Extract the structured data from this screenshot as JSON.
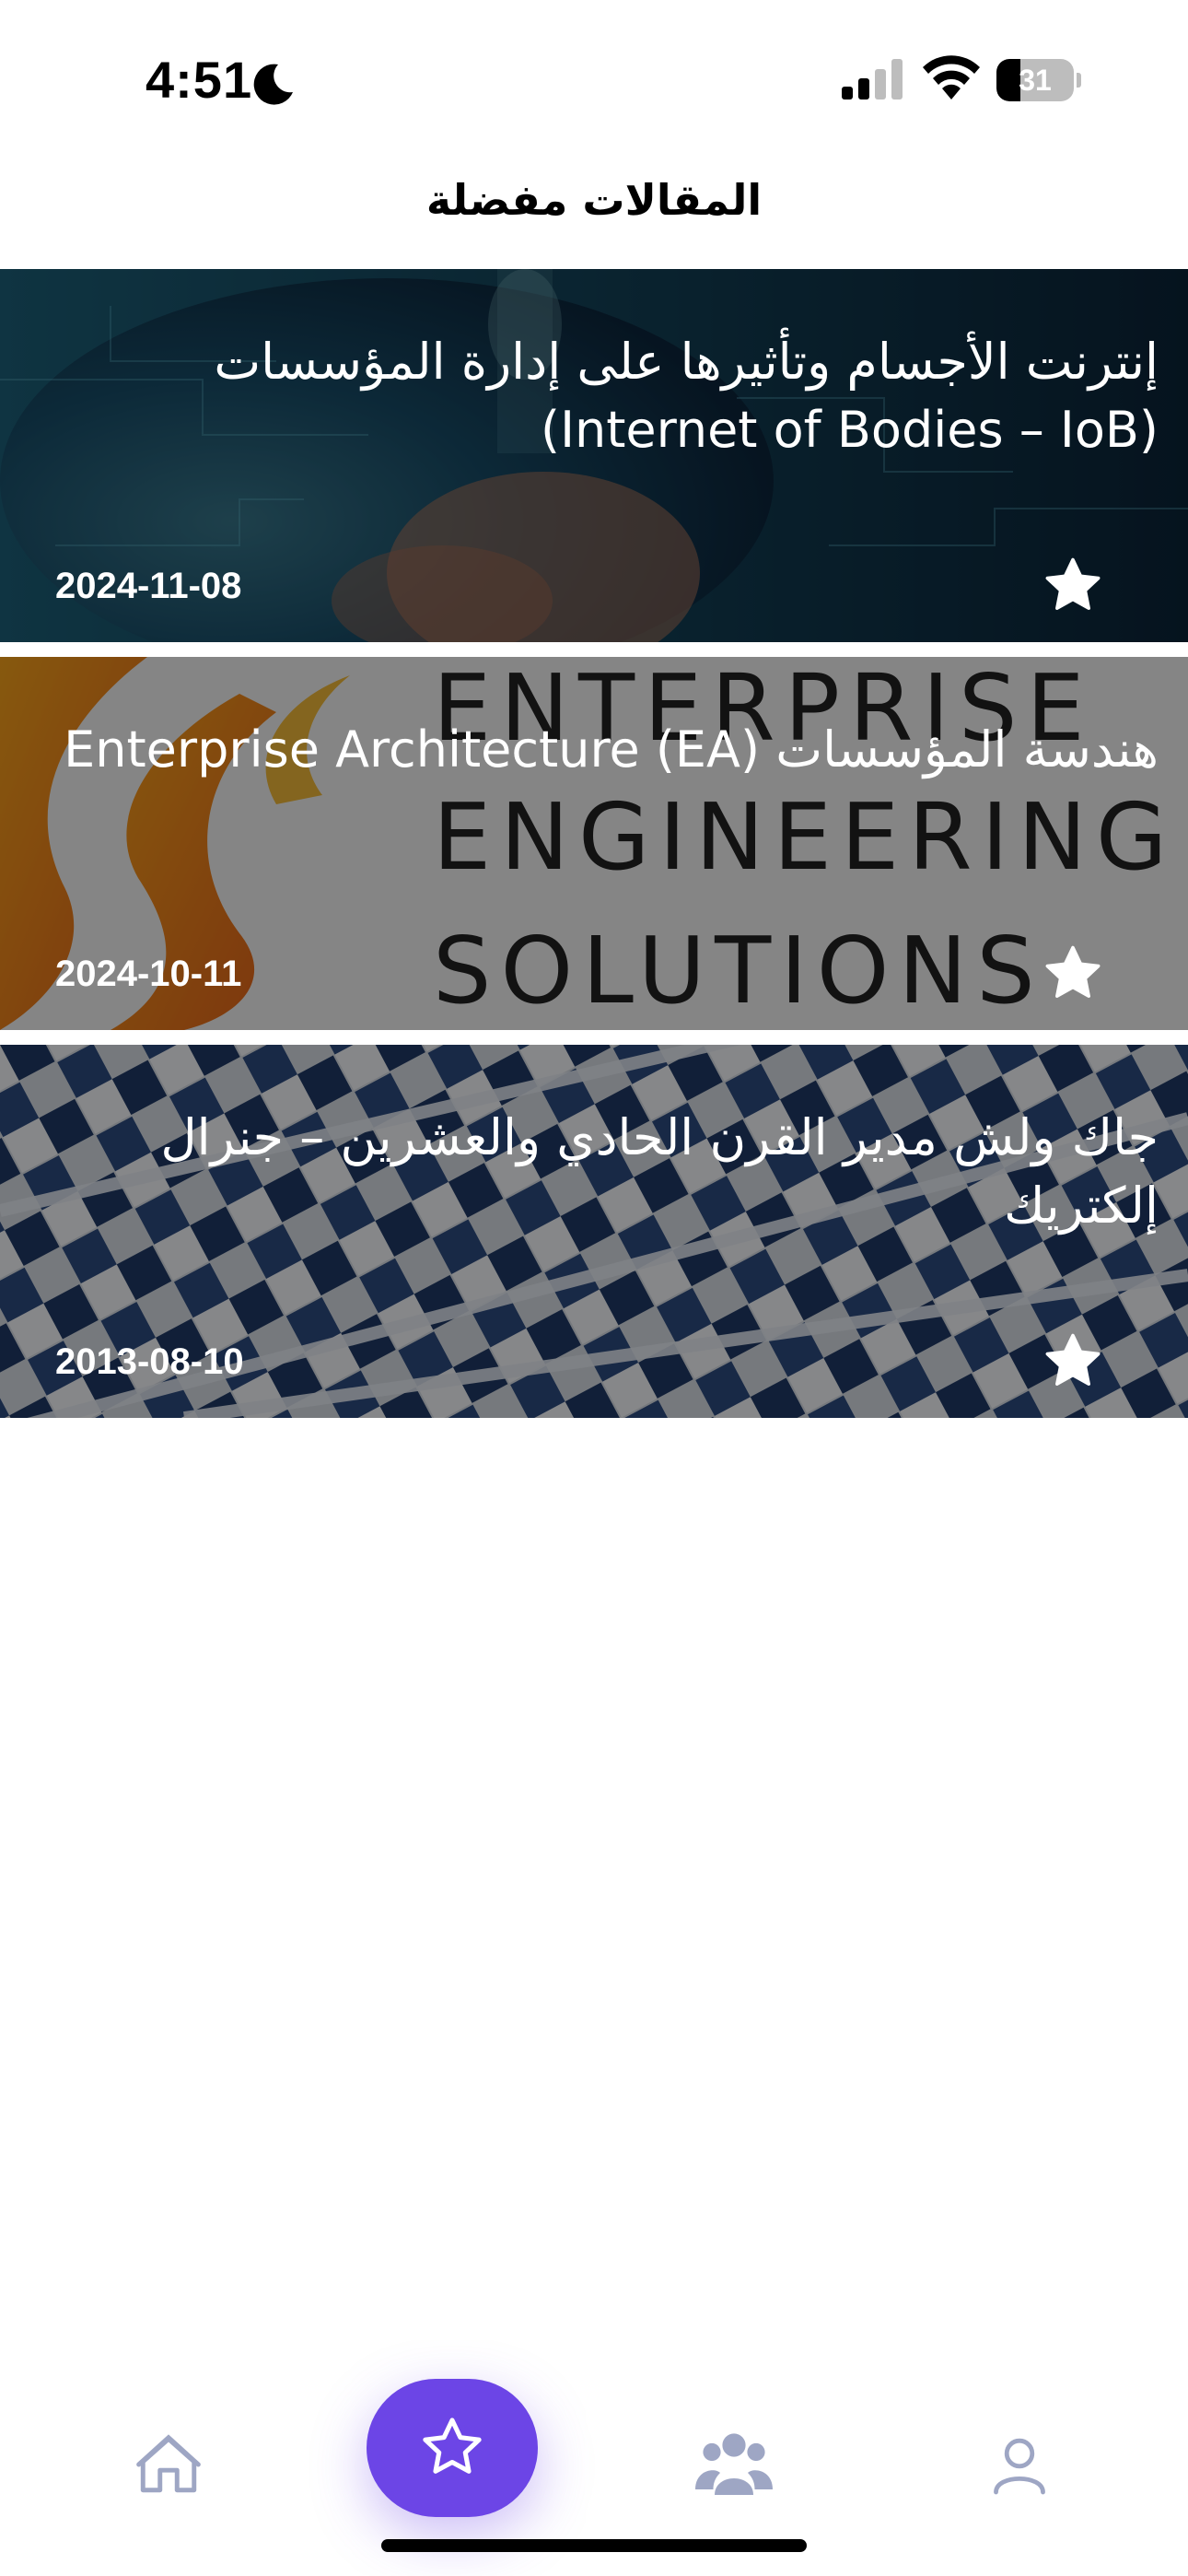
{
  "status_bar": {
    "time": "4:51",
    "battery_percent": "31",
    "battery_level": 0.31,
    "icons": [
      "moon-icon",
      "cellular-signal-icon",
      "wifi-icon",
      "battery-icon"
    ]
  },
  "header": {
    "title": "المقالات مفضلة"
  },
  "articles": [
    {
      "title": "إنترنت الأجسام وتأثيرها على إدارة المؤسسات (Internet of Bodies – IoB)",
      "date": "2024-11-08",
      "favorited": true
    },
    {
      "title": "هندسة المؤسسات Enterprise Architecture (EA)",
      "date": "2024-10-11",
      "favorited": true
    },
    {
      "title": "جاك ولش مدير القرن الحادي والعشرين – جنرال إلكتريك",
      "date": "2013-08-10",
      "favorited": true
    }
  ],
  "bottom_nav": {
    "items": [
      {
        "icon": "home-icon",
        "active": false
      },
      {
        "icon": "star-icon",
        "active": true
      },
      {
        "icon": "group-icon",
        "active": false
      },
      {
        "icon": "profile-icon",
        "active": false
      }
    ]
  },
  "colors": {
    "accent": "#6c45e6",
    "inactive_icon": "#9ea6c4"
  }
}
